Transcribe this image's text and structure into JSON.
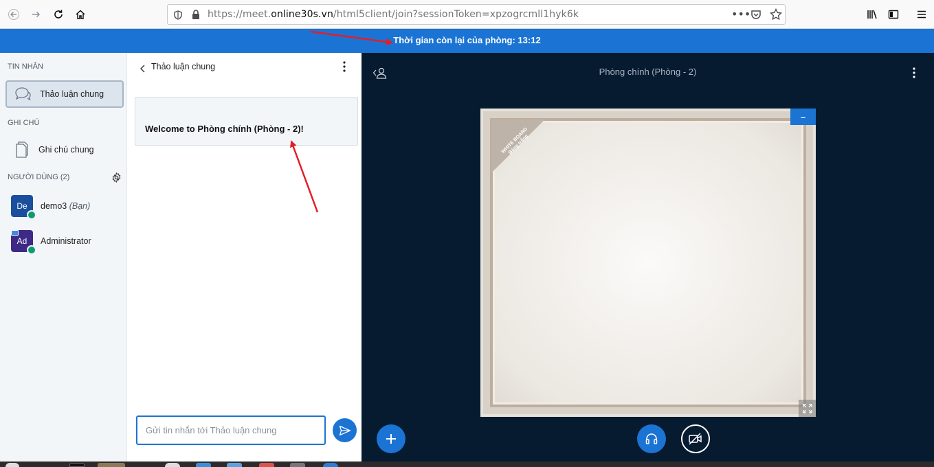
{
  "browser": {
    "url_prefix": "https://meet.",
    "url_domain": "online30s.vn",
    "url_path": "/html5client/join?sessionToken=xpzogrcmll1hyk6k"
  },
  "timer": {
    "label": "Thời gian còn lại của phòng: 13:12"
  },
  "sidebar": {
    "messages_title": "TIN NHẮN",
    "public_chat_label": "Thảo luận chung",
    "notes_title": "GHI CHÚ",
    "shared_notes_label": "Ghi chú chung",
    "users_title": "NGƯỜI DÙNG (2)",
    "users": [
      {
        "initials": "De",
        "name": "demo3",
        "suffix": "(Bạn)",
        "color": "#1a4f9e"
      },
      {
        "initials": "Ad",
        "name": "Administrator",
        "suffix": "",
        "color": "#3c2a86"
      }
    ]
  },
  "chat": {
    "header_title": "Thảo luận chung",
    "welcome_prefix": "Welcome to ",
    "welcome_room": "Phòng chính (Phòng - 2)",
    "welcome_suffix": "!",
    "input_placeholder": "Gửi tin nhắn tới Thảo luận chung"
  },
  "presentation": {
    "room_title": "Phòng chính (Phòng - 2)",
    "whiteboard_corner_line1": "WHITE BOARD",
    "whiteboard_corner_line2": "Bảng trắng",
    "minimize_symbol": "–"
  },
  "colors": {
    "accent": "#1b74d3",
    "main_bg": "#061a30",
    "annotation_arrow": "#e41e26"
  }
}
